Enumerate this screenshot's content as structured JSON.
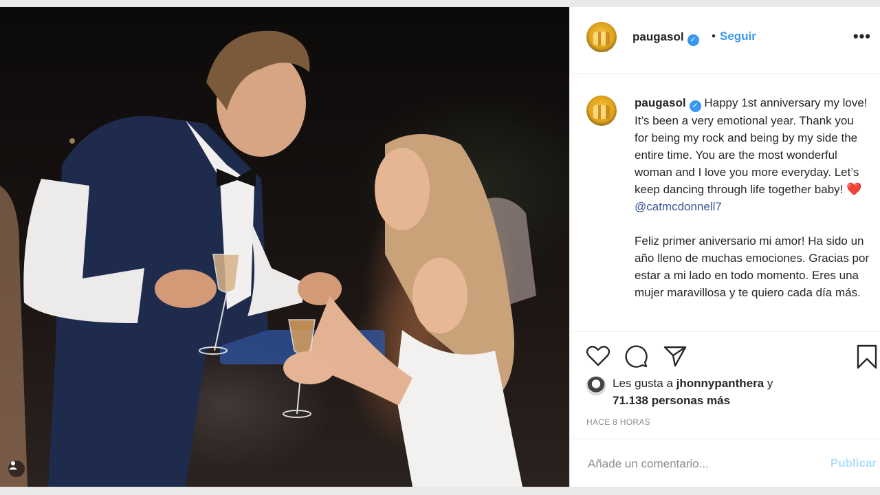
{
  "post": {
    "username": "paugasol",
    "follow_label": "Seguir",
    "dot": "•",
    "more_label": "•••",
    "verified_mark": "✓"
  },
  "caption": {
    "username": "paugasol",
    "text_en": "Happy 1st anniversary my love! It’s been a very emotional year. Thank you for being my rock and being by my side the entire time. You are the most wonderful woman and I love you more everyday. Let’s keep dancing through life together baby!",
    "heart": "❤️",
    "mention": "@catmcdonnell7",
    "text_es": "Feliz primer aniversario mi amor! Ha sido un año lleno de muchas emociones. Gracias por estar a mi lado en todo momento. Eres una mujer maravillosa y te quiero cada día más."
  },
  "actions": {
    "icons": [
      "heart-icon",
      "comment-icon",
      "share-icon",
      "bookmark-icon"
    ]
  },
  "likes": {
    "prefix": "Les gusta a ",
    "user": "jhonnypanthera",
    "connector": " y",
    "count": "71.138 personas más"
  },
  "timestamp": "HACE 8 HORAS",
  "comment": {
    "placeholder": "Añade un comentario...",
    "publish_label": "Publicar"
  },
  "colors": {
    "link_blue": "#3897f0",
    "publish_disabled": "#b2dffc",
    "heart_red": "#e0182d"
  }
}
